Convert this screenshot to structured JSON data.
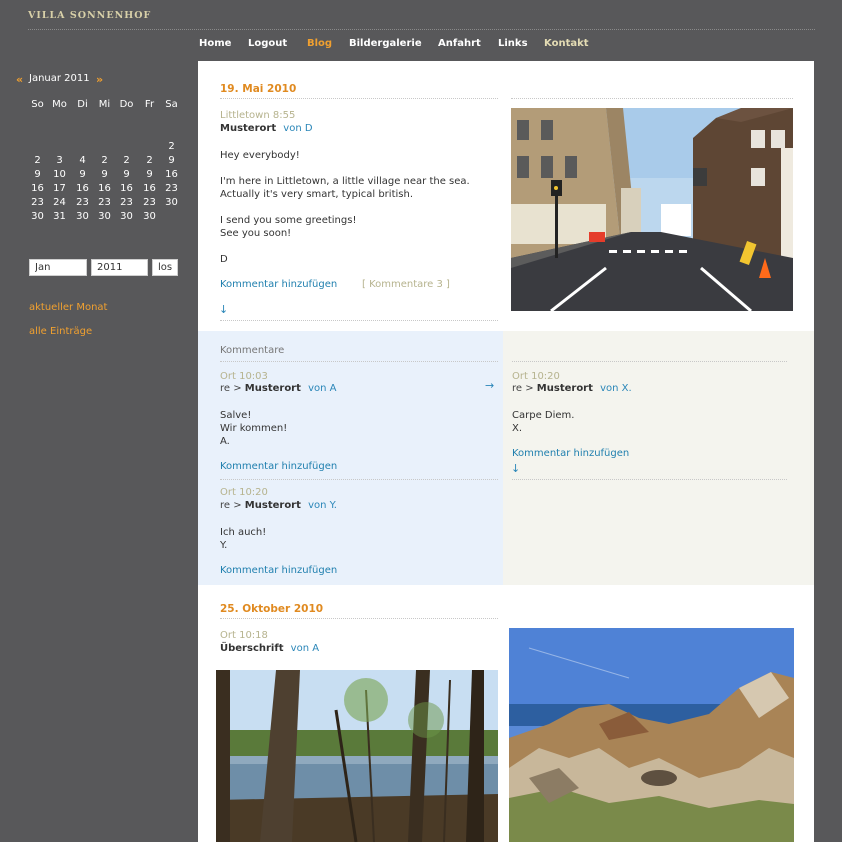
{
  "site": {
    "title": "VILLA SONNENHOF"
  },
  "nav": {
    "items": [
      {
        "label": "Home"
      },
      {
        "label": "Logout"
      },
      {
        "label": "Blog"
      },
      {
        "label": "Bildergalerie"
      },
      {
        "label": "Anfahrt"
      },
      {
        "label": "Links"
      },
      {
        "label": "Kontakt"
      }
    ],
    "active": "Blog",
    "accent_color": "#f0a030"
  },
  "sidebar": {
    "calendar": {
      "prev_symbol": "«",
      "next_symbol": "»",
      "title": "Januar 2011",
      "weekdays": [
        "So",
        "Mo",
        "Di",
        "Mi",
        "Do",
        "Fr",
        "Sa"
      ],
      "rows": [
        [
          "",
          "",
          "",
          "",
          "",
          "",
          "2"
        ],
        [
          "",
          "",
          "",
          "",
          "",
          "",
          ""
        ],
        [
          "2",
          "3",
          "4",
          "2",
          "2",
          "2",
          "9"
        ],
        [
          "9",
          "10",
          "9",
          "9",
          "9",
          "9",
          "16"
        ],
        [
          "16",
          "17",
          "16",
          "16",
          "16",
          "16",
          "23"
        ],
        [
          "23",
          "24",
          "23",
          "23",
          "23",
          "23",
          "30"
        ],
        [
          "30",
          "31",
          "30",
          "30",
          "30",
          "30",
          ""
        ]
      ],
      "today": "23"
    },
    "form": {
      "month_value": "Jan",
      "year_value": "2011",
      "submit_label": "los"
    },
    "links": {
      "current_month": "aktueller Monat",
      "all_entries": "alle Einträge"
    }
  },
  "post1": {
    "date": "19. Mai 2010",
    "meta": "Littletown 8:55",
    "title": "Musterort",
    "author": "von D",
    "body": [
      "Hey everybody!",
      "I'm here in Littletown, a little village near the sea.",
      "Actually it's very smart, typical british.",
      "I send you some greetings!",
      "See you soon!",
      "D"
    ],
    "add_comment": "Kommentar hinzufügen",
    "comment_count": "[ Kommentare 3 ]",
    "down_arrow": "↓",
    "comments_heading": "Kommentare",
    "comments": [
      {
        "meta": "Ort 10:03",
        "re": "re >",
        "title": "Musterort",
        "author": "von A",
        "body": [
          "Salve!",
          "Wir kommen!",
          "A."
        ],
        "add_comment": "Kommentar hinzufügen",
        "arrow": "→"
      },
      {
        "meta": "Ort 10:20",
        "re": "re >",
        "title": "Musterort",
        "author": "von Y.",
        "body": [
          "Ich auch!",
          "Y."
        ],
        "add_comment": "Kommentar hinzufügen"
      },
      {
        "meta": "Ort 10:20",
        "re": "re >",
        "title": "Musterort",
        "author": "von X.",
        "body": [
          "Carpe Diem.",
          "X."
        ],
        "add_comment": "Kommentar hinzufügen",
        "down_arrow": "↓"
      }
    ]
  },
  "post2": {
    "date": "25. Oktober 2010",
    "meta": "Ort 10:18",
    "title": "Überschrift",
    "author": "von A"
  }
}
